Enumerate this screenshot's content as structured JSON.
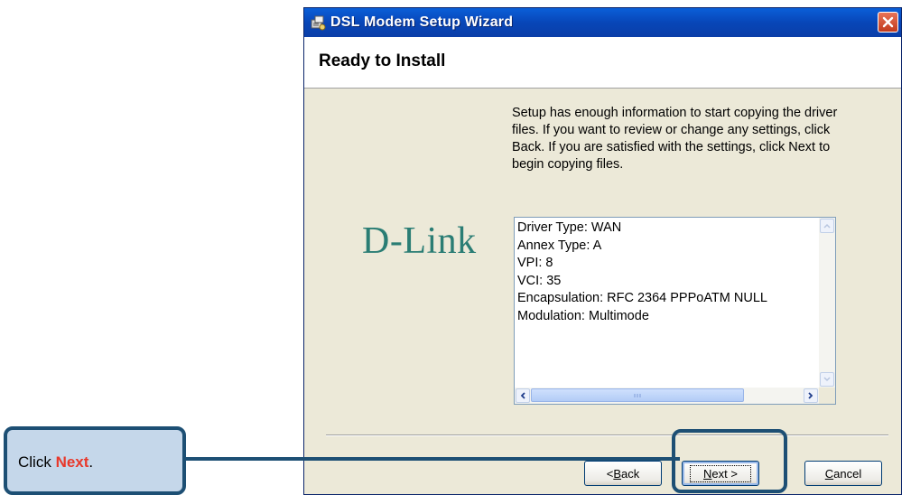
{
  "window": {
    "title": "DSL Modem Setup Wizard",
    "header_title": "Ready to Install"
  },
  "logo": {
    "text": "D-Link",
    "color": "#2a7d74"
  },
  "description": "Setup has enough information to start copying the driver files.  If you want to review or change any settings, click Back.  If you are satisfied with the settings, click Next to begin copying files.",
  "settings_list": [
    "Driver Type: WAN",
    "Annex Type: A",
    "VPI: 8",
    "VCI: 35",
    "Encapsulation: RFC 2364 PPPoATM NULL",
    "Modulation: Multimode"
  ],
  "buttons": {
    "back": {
      "pre": "< ",
      "u": "B",
      "post": "ack"
    },
    "next": {
      "u": "N",
      "post": "ext >"
    },
    "cancel": {
      "u": "C",
      "post": "ancel"
    }
  },
  "callout": {
    "prefix": "Click ",
    "strong": "Next",
    "suffix": "."
  },
  "icons": [
    "setup-wizard-icon",
    "close-icon",
    "scroll-up-icon",
    "scroll-down-icon",
    "scroll-left-icon",
    "scroll-right-icon"
  ],
  "colors": {
    "titlebar": "#0846b8",
    "callout_border": "#1d4f74",
    "callout_fill": "#c5d7ea",
    "callout_accent": "#e8382b"
  }
}
